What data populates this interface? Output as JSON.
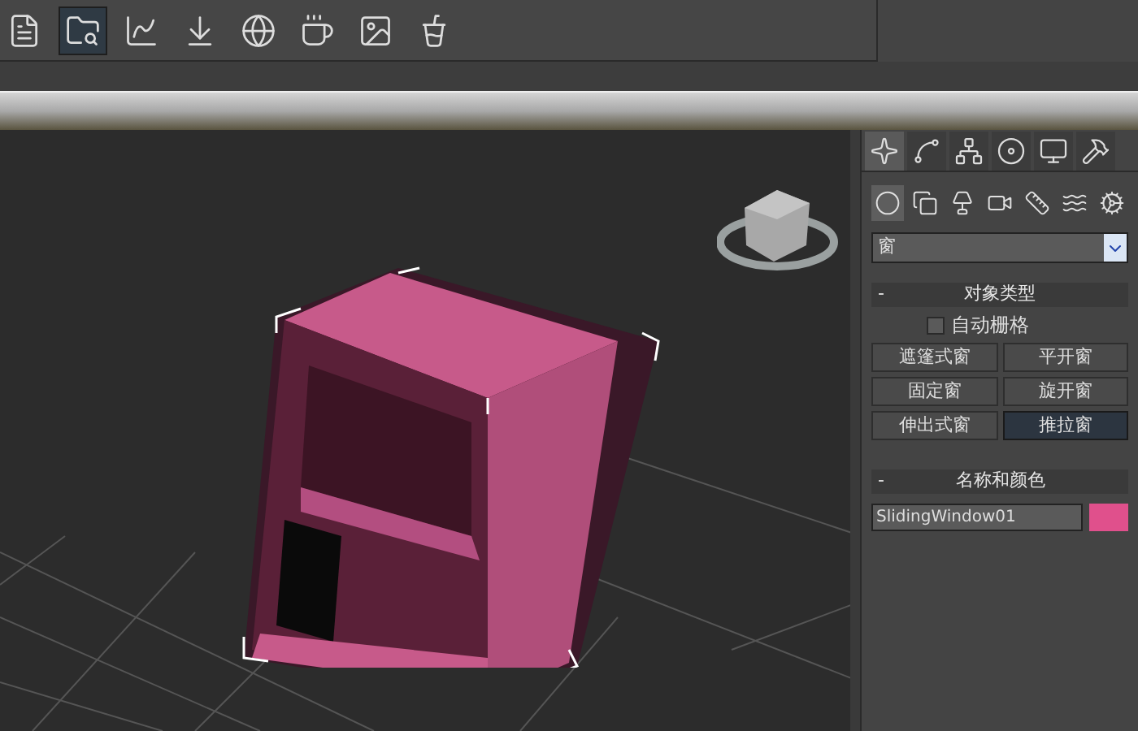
{
  "toolbar": {
    "buttons": [
      {
        "kind": "sheet",
        "selected": false
      },
      {
        "kind": "explorer",
        "selected": true
      },
      {
        "kind": "curve",
        "selected": false
      },
      {
        "kind": "import",
        "selected": false
      },
      {
        "kind": "material",
        "selected": false
      },
      {
        "kind": "render-setup",
        "selected": false
      },
      {
        "kind": "render-frame",
        "selected": false
      },
      {
        "kind": "render",
        "selected": false
      }
    ]
  },
  "command_panel": {
    "tabs": [
      {
        "kind": "create",
        "selected": true
      },
      {
        "kind": "modify",
        "selected": false
      },
      {
        "kind": "hierarchy",
        "selected": false
      },
      {
        "kind": "motion",
        "selected": false
      },
      {
        "kind": "display",
        "selected": false
      },
      {
        "kind": "utilities",
        "selected": false
      }
    ],
    "categories": [
      {
        "kind": "geometry",
        "selected": true
      },
      {
        "kind": "shapes",
        "selected": false
      },
      {
        "kind": "lights",
        "selected": false
      },
      {
        "kind": "cameras",
        "selected": false
      },
      {
        "kind": "helpers",
        "selected": false
      },
      {
        "kind": "spacewarps",
        "selected": false
      },
      {
        "kind": "systems",
        "selected": false
      }
    ],
    "dropdown": {
      "value": "窗"
    },
    "object_type": {
      "collapse_sign": "-",
      "title": "对象类型",
      "auto_grid": {
        "label": "自动栅格",
        "checked": false
      },
      "buttons": [
        {
          "label": "遮篷式窗",
          "selected": false
        },
        {
          "label": "平开窗",
          "selected": false
        },
        {
          "label": "固定窗",
          "selected": false
        },
        {
          "label": "旋开窗",
          "selected": false
        },
        {
          "label": "伸出式窗",
          "selected": false
        },
        {
          "label": "推拉窗",
          "selected": true
        }
      ]
    },
    "name_and_color": {
      "collapse_sign": "-",
      "title": "名称和颜色",
      "name_value": "SlidingWindow01",
      "color": "#e0508c"
    }
  }
}
